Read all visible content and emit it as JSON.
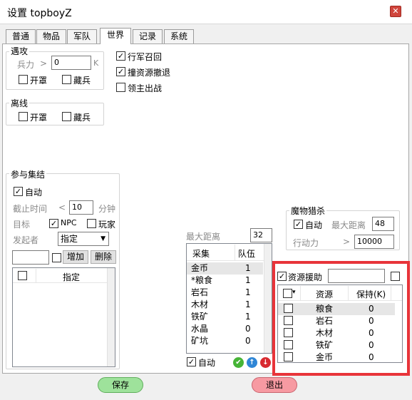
{
  "window": {
    "title": "设置 topboyZ",
    "close": "✕"
  },
  "tabs": [
    "普通",
    "物品",
    "军队",
    "世界",
    "记录",
    "系统"
  ],
  "encounter": {
    "title": "遇攻",
    "troop_label": "兵力",
    "troop_gt": ">",
    "troop_value": "0",
    "troop_unit": "K",
    "open_cover": "开罩",
    "hide_troops": "藏兵"
  },
  "options": {
    "march_recall": "行军召回",
    "resource_retreat": "撞资源撤退",
    "lord_attack": "领主出战"
  },
  "offline": {
    "title": "离线",
    "open_cover": "开罩",
    "hide_troops": "藏兵"
  },
  "rally": {
    "title": "参与集结",
    "auto": "自动",
    "deadline_label": "截止时间",
    "deadline_lt": "<",
    "deadline_value": "10",
    "deadline_unit": "分钟",
    "target_label": "目标",
    "npc": "NPC",
    "player": "玩家",
    "initiator_label": "发起者",
    "initiator_select": "指定",
    "add_button": "增加",
    "delete_button": "删除",
    "list_header": "指定"
  },
  "gather": {
    "max_distance_label": "最大距离",
    "max_distance_value": "32",
    "col_gather": "采集",
    "col_team": "队伍",
    "rows": [
      {
        "name": "金币",
        "team": "1"
      },
      {
        "name": "*粮食",
        "team": "1"
      },
      {
        "name": "岩石",
        "team": "1"
      },
      {
        "name": "木材",
        "team": "1"
      },
      {
        "name": "铁矿",
        "team": "1"
      },
      {
        "name": "水晶",
        "team": "0"
      },
      {
        "name": "矿坑",
        "team": "0"
      }
    ],
    "auto": "自动",
    "check_icon": "✔",
    "up_icon": "↑",
    "down_icon": "↓"
  },
  "monster": {
    "title": "魔物猎杀",
    "auto": "自动",
    "max_distance_label": "最大距离",
    "max_distance_value": "48",
    "stamina_label": "行动力",
    "stamina_gt": ">",
    "stamina_value": "10000"
  },
  "resource_aid": {
    "label": "资源援助",
    "col_resource": "资源",
    "col_keep": "保持(K)",
    "rows": [
      {
        "name": "粮食",
        "keep": "0"
      },
      {
        "name": "岩石",
        "keep": "0"
      },
      {
        "name": "木材",
        "keep": "0"
      },
      {
        "name": "铁矿",
        "keep": "0"
      },
      {
        "name": "金币",
        "keep": "0"
      }
    ]
  },
  "footer": {
    "save": "保存",
    "exit": "退出"
  },
  "checkmark": "✓",
  "colors": {
    "highlight_border": "#e8343a",
    "save_green": "#9ee29b",
    "exit_red": "#f79aa2"
  }
}
